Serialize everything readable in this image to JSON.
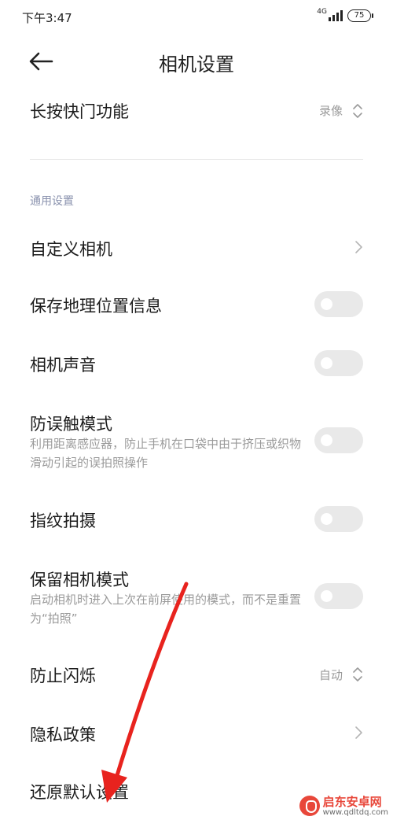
{
  "status_bar": {
    "time": "下午3:47",
    "network": "4G",
    "battery": "75"
  },
  "header": {
    "title": "相机设置"
  },
  "shutter_row": {
    "title": "长按快门功能",
    "value": "录像"
  },
  "section": {
    "label": "通用设置"
  },
  "rows": {
    "custom_camera": {
      "title": "自定义相机"
    },
    "save_location": {
      "title": "保存地理位置信息",
      "on": false
    },
    "camera_sound": {
      "title": "相机声音",
      "on": false
    },
    "anti_mistouch": {
      "title": "防误触模式",
      "desc": "利用距离感应器，防止手机在口袋中由于挤压或织物滑动引起的误拍照操作",
      "on": false
    },
    "fingerprint": {
      "title": "指纹拍摄",
      "on": false
    },
    "keep_mode": {
      "title": "保留相机模式",
      "desc": "启动相机时进入上次在前屏使用的模式，而不是重置为“拍照”",
      "on": false
    },
    "anti_flicker": {
      "title": "防止闪烁",
      "value": "自动"
    },
    "privacy": {
      "title": "隐私政策"
    },
    "restore": {
      "title": "还原默认设置"
    }
  },
  "colors": {
    "accent_arrow": "#e8231e",
    "section_label": "#8a92ae",
    "toggle_off": "#e9e9e9"
  },
  "watermark": {
    "name": "启东安卓网",
    "url": "www.qdltdq.com"
  }
}
